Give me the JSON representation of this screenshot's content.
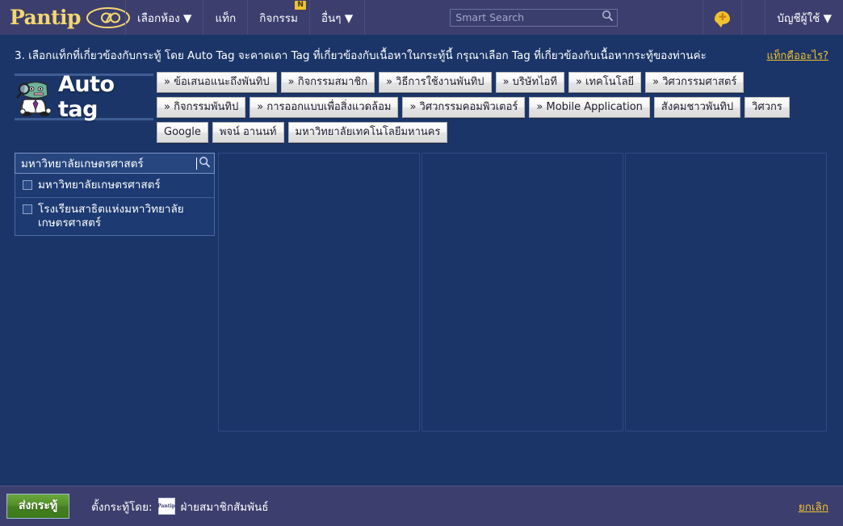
{
  "header": {
    "brand": "Pantip",
    "brand_icon": "pantip-infinity-logo",
    "nav": [
      {
        "label": "เลือกห้อง ▼",
        "badge": ""
      },
      {
        "label": "แท็ก",
        "badge": ""
      },
      {
        "label": "กิจกรรม",
        "badge": "N"
      },
      {
        "label": "อื่นๆ ▼",
        "badge": ""
      }
    ],
    "search": {
      "placeholder": "Smart Search",
      "value": "",
      "icon": "search-icon"
    },
    "notification_icon": "speech-bubble-icon",
    "account_label": "บัญชีผู้ใช้ ▼"
  },
  "main": {
    "instruction": "3. เลือกแท็กที่เกี่ยวข้องกับกระทู้ โดย Auto Tag จะคาดเดา Tag ที่เกี่ยวข้องกับเนื้อหาในกระทู้นี้ กรุณาเลือก Tag ที่เกี่ยวข้องกับเนื้อหากระทู้ของท่านค่ะ",
    "help_link": "แท็กคืออะไร?",
    "autotag_title": "Auto tag",
    "autotag_mascot": "detective-robot-mascot",
    "suggested_tags": [
      "» ข้อเสนอแนะถึงพันทิป",
      "» กิจกรรมสมาชิก",
      "» วิธีการใช้งานพันทิป",
      "» บริษัทไอที",
      "» เทคโนโลยี",
      "» วิศวกรรมศาสตร์",
      "» กิจกรรมพันทิป",
      "» การออกแบบเพื่อสิ่งแวดล้อม",
      "» วิศวกรรมคอมพิวเตอร์",
      "» Mobile Application",
      "สังคมชาวพันทิป",
      "วิศวกร",
      "Google",
      "พจน์ อานนท์",
      "มหาวิทยาลัยเทคโนโลยีมหานคร"
    ],
    "tag_search": {
      "value": "มหาวิทยาลัยเกษตรศาสตร์",
      "placeholder": "",
      "icon": "search-icon"
    },
    "results": [
      {
        "label": "มหาวิทยาลัยเกษตรศาสตร์",
        "checked": false
      },
      {
        "label": "โรงเรียนสาธิตแห่งมหาวิทยาลัยเกษตรศาสตร์",
        "checked": false
      }
    ]
  },
  "footer": {
    "submit_label": "ส่งกระทู้",
    "posted_by_label": "ตั้งกระทู้โดย:",
    "poster_avatar": "pantip-avatar",
    "poster_avatar_text": "Pantip",
    "poster_name": "ฝ่ายสมาชิกสัมพันธ์",
    "cancel_label": "ยกเลิก"
  },
  "colors": {
    "page_bg": "#1b3569",
    "chrome_bg": "#3c3f6e",
    "accent_yellow": "#f2c12e",
    "submit_green": "#4f8c27"
  }
}
